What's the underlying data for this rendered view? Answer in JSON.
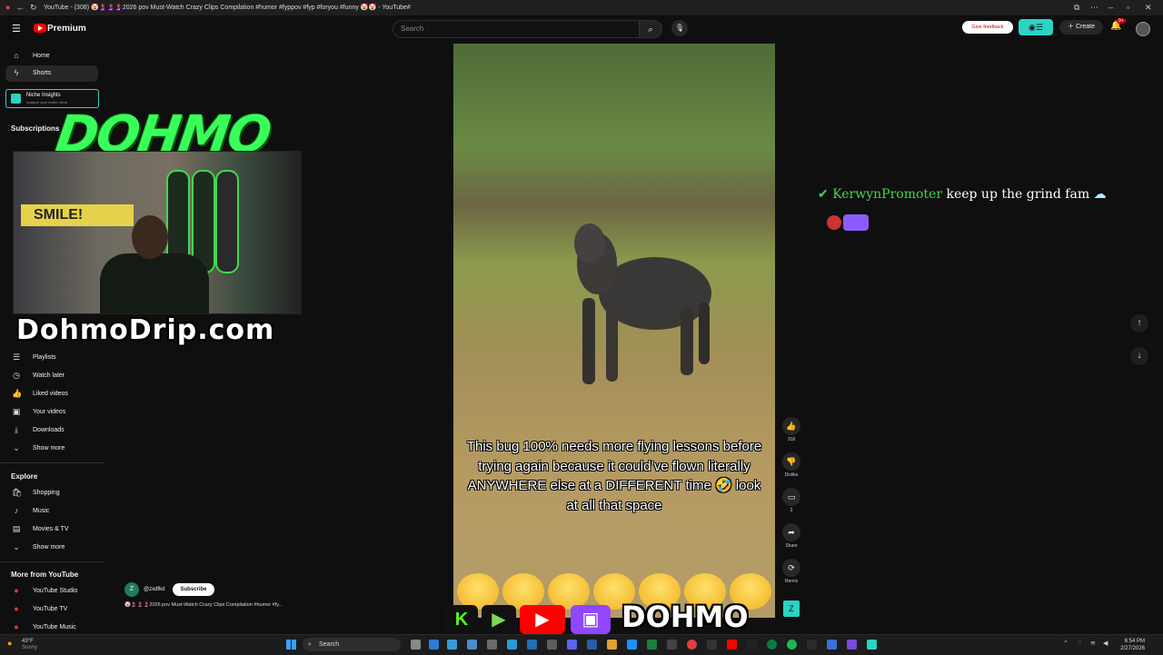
{
  "window": {
    "tab_title": "YouTube - (308) 🤡🤰🤰🤰2026 pov Must-Watch Crazy Clips Compilation #humor #fyp⁧ #pov #fyp #foryou #funny 🤡🤡 - YouTube"
  },
  "masthead": {
    "logo_text": "Premium",
    "search_placeholder": "Search",
    "feedback_label": "Give feedback",
    "create_label": "Create",
    "notifications_badge": "9+"
  },
  "sidebar": {
    "top_items": [
      {
        "label": "Home",
        "icon": "home-icon"
      },
      {
        "label": "Shorts",
        "icon": "shorts-icon"
      }
    ],
    "niche": {
      "title": "Niche Insights",
      "subtitle": "Analyze your entire niche"
    },
    "subscriptions_header": "Subscriptions",
    "you_items": [
      {
        "label": "Playlists",
        "icon": "playlists-icon"
      },
      {
        "label": "Watch later",
        "icon": "clock-icon"
      },
      {
        "label": "Liked videos",
        "icon": "thumb-up-icon"
      },
      {
        "label": "Your videos",
        "icon": "video-icon"
      },
      {
        "label": "Downloads",
        "icon": "download-icon"
      },
      {
        "label": "Show more",
        "icon": "chevron-down-icon"
      }
    ],
    "explore_header": "Explore",
    "explore_items": [
      {
        "label": "Shopping",
        "icon": "shopping-icon"
      },
      {
        "label": "Music",
        "icon": "music-icon"
      },
      {
        "label": "Movies & TV",
        "icon": "film-icon"
      },
      {
        "label": "Show more",
        "icon": "chevron-down-icon"
      }
    ],
    "more_header": "More from YouTube",
    "more_items": [
      {
        "label": "YouTube Studio"
      },
      {
        "label": "YouTube TV"
      },
      {
        "label": "YouTube Music"
      }
    ]
  },
  "overlay": {
    "stream_logo": "DOHMO",
    "webcam_sign": "SMILE!",
    "website": "DohmoDrip.com",
    "bottom_brand": "DOHMO"
  },
  "video": {
    "caption": "This bug 100% needs more flying lessons before trying again because it could’ve flown literally ANYWHERE else at a DIFFERENT time 🤣 look at all that space"
  },
  "actions": [
    {
      "icon": "thumb-up-icon",
      "label": "318"
    },
    {
      "icon": "thumb-down-icon",
      "label": "Dislike"
    },
    {
      "icon": "comment-icon",
      "label": "2"
    },
    {
      "icon": "share-icon",
      "label": "Share"
    },
    {
      "icon": "remix-icon",
      "label": "Remix"
    }
  ],
  "channel": {
    "avatar_letter": "Z",
    "handle": "@zxdfkd",
    "subscribe_label": "Subscribe",
    "video_title": "🤡🤰🤰🤰2026 pov Must-Watch Crazy Clips Compilation #humor #fy..."
  },
  "chat": {
    "user": "KerwynPromoter",
    "message": "keep up the grind fam"
  },
  "taskbar": {
    "temperature": "43°F",
    "weather": "Sunny",
    "search_label": "Search",
    "time": "6:54 PM",
    "date": "2/27/2026"
  },
  "colors": {
    "accent_green": "#39ff5a",
    "youtube_red": "#ff0000",
    "niche_teal": "#2bd3c5"
  }
}
